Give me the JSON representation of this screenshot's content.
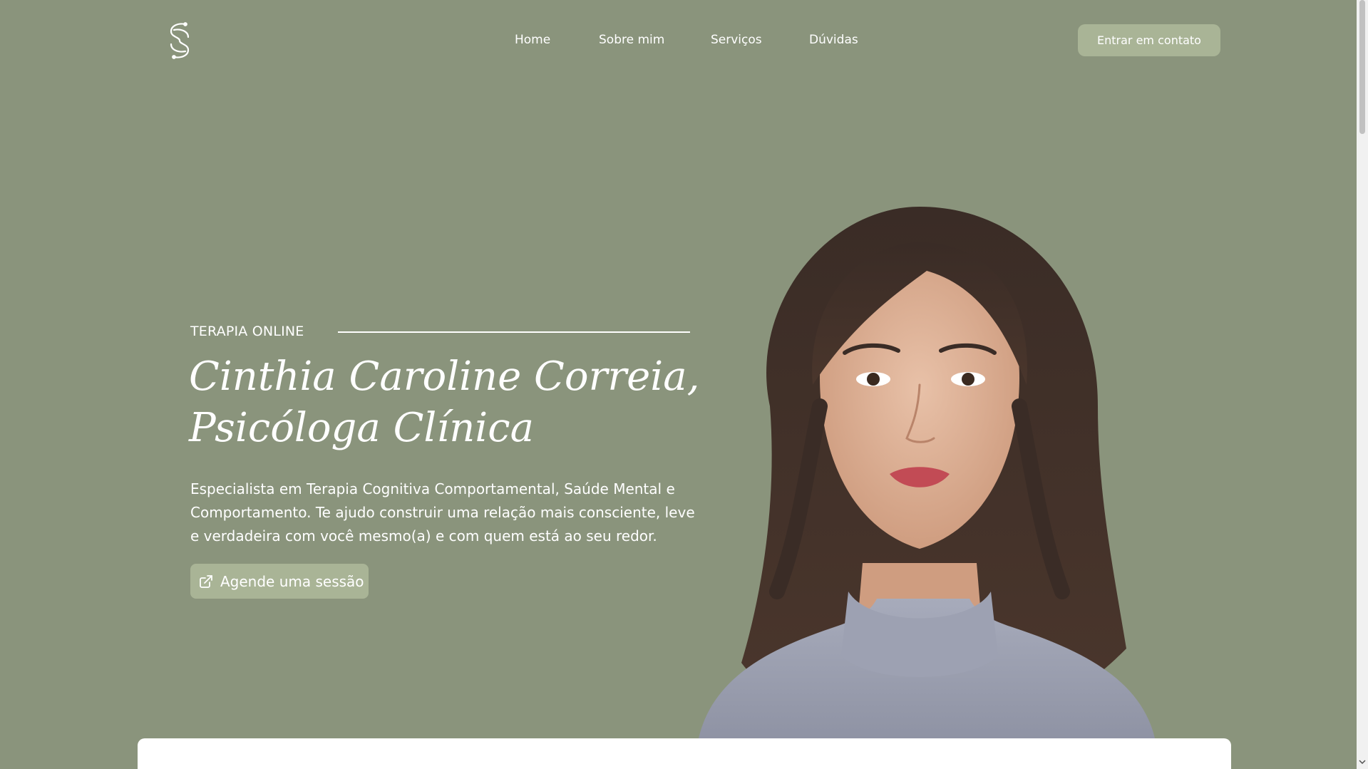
{
  "header": {
    "logo_icon": "infinity-swirl-logo-icon",
    "nav": [
      {
        "label": "Home"
      },
      {
        "label": "Sobre mim"
      },
      {
        "label": "Serviços"
      },
      {
        "label": "Dúvidas"
      }
    ],
    "cta_label": "Entrar em contato"
  },
  "hero": {
    "eyebrow": "TERAPIA ONLINE",
    "headline_line1": "Cinthia Caroline Correia,",
    "headline_line2": "Psicóloga Clínica",
    "description": "Especialista em Terapia Cognitiva Comportamental, Saúde Mental e Comportamento. Te ajudo construir uma relação mais consciente, leve e verdadeira com você mesmo(a) e com quem está ao seu redor.",
    "cta_label": "Agende uma sessão",
    "cta_icon": "external-link-icon",
    "portrait_icon": "portrait-photo"
  },
  "colors": {
    "background": "#8a947c",
    "button": "#a9b496",
    "text": "#ffffff"
  }
}
